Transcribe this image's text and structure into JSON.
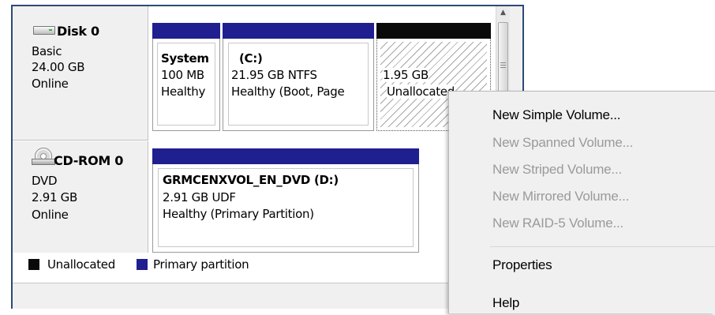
{
  "disks": [
    {
      "name": "Disk 0",
      "type": "Basic",
      "size": "24.00 GB",
      "status": "Online",
      "icon": "disk-icon",
      "partitions": [
        {
          "name": "System",
          "size": "100 MB",
          "status": "Healthy",
          "kind": "primary"
        },
        {
          "name": "(C:)",
          "size": "21.95 GB NTFS",
          "status": "Healthy (Boot, Page",
          "kind": "primary"
        },
        {
          "name": "",
          "size": "1.95 GB",
          "status": "Unallocated",
          "kind": "unallocated"
        }
      ]
    },
    {
      "name": "CD-ROM 0",
      "type": "DVD",
      "size": "2.91 GB",
      "status": "Online",
      "icon": "cdrom-icon",
      "partitions": [
        {
          "name": "GRMCENXVOL_EN_DVD  (D:)",
          "size": "2.91 GB UDF",
          "status": "Healthy (Primary Partition)",
          "kind": "primary"
        }
      ]
    }
  ],
  "legend": [
    {
      "label": "Unallocated",
      "color": "#0a0a0a"
    },
    {
      "label": "Primary partition",
      "color": "#1f1f8f"
    }
  ],
  "context_menu": {
    "items": [
      {
        "label": "New Simple Volume...",
        "enabled": true
      },
      {
        "label": "New Spanned Volume...",
        "enabled": false
      },
      {
        "label": "New Striped Volume...",
        "enabled": false
      },
      {
        "label": "New Mirrored Volume...",
        "enabled": false
      },
      {
        "label": "New RAID-5 Volume...",
        "enabled": false
      },
      {
        "label": "Properties",
        "enabled": true
      },
      {
        "label": "Help",
        "enabled": true
      }
    ]
  },
  "colors": {
    "primary_partition": "#1f1f8f",
    "unallocated": "#0a0a0a",
    "window_border": "#2b4a78",
    "menu_background": "#f0f0f0",
    "disabled_text": "#9a9a9a"
  }
}
